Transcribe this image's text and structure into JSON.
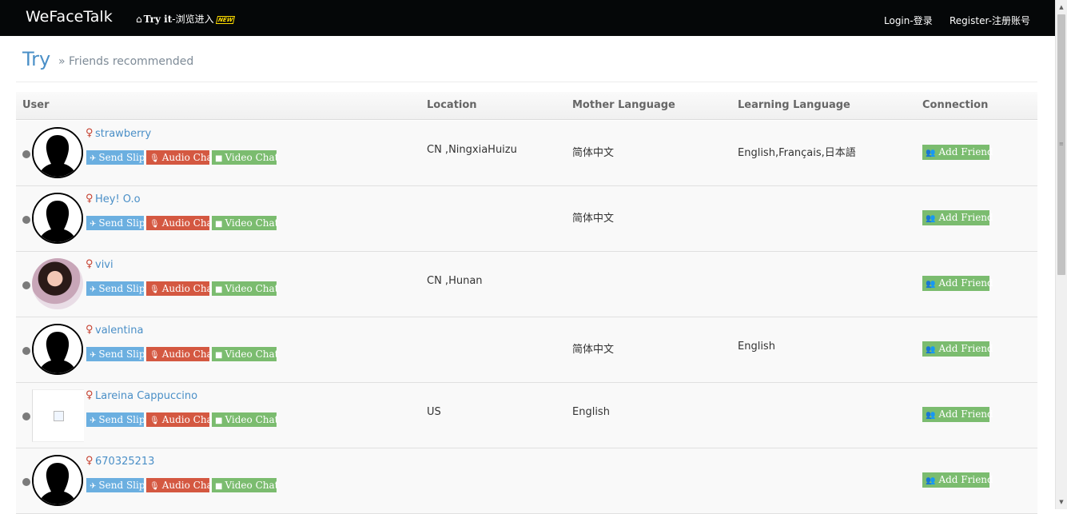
{
  "nav": {
    "brand": "WeFaceTalk",
    "try_icon": "home-icon",
    "try_label": "Try it",
    "try_cn": "-浏览进入",
    "new_badge": "NEW",
    "login": "Login-登录",
    "register": "Register-注册账号"
  },
  "page": {
    "title": "Try",
    "subtitle": "» Friends recommended"
  },
  "table": {
    "headers": {
      "user": "User",
      "location": "Location",
      "mother": "Mother Language",
      "learning": "Learning Language",
      "connection": "Connection"
    },
    "buttons": {
      "send_slip": "Send Slip",
      "audio_chat": "Audio Chat",
      "video_chat": "Video Chat",
      "add_friend": "Add Friend"
    },
    "gender_symbol": "♀",
    "rows": [
      {
        "name": "strawberry",
        "location": "CN ,NingxiaHuizu",
        "mother": "简体中文",
        "learning": "English,Français,日本語",
        "avatar": "silhouette"
      },
      {
        "name": "Hey! O.o",
        "location": "",
        "mother": "简体中文",
        "learning": "",
        "avatar": "silhouette"
      },
      {
        "name": "vivi",
        "location": "CN ,Hunan",
        "mother": "",
        "learning": "",
        "avatar": "photo"
      },
      {
        "name": "valentina",
        "location": "",
        "mother": "简体中文",
        "learning": "English",
        "avatar": "silhouette"
      },
      {
        "name": "Lareina Cappuccino",
        "location": "US",
        "mother": "English",
        "learning": "",
        "avatar": "broken-image"
      },
      {
        "name": "670325213",
        "location": "",
        "mother": "",
        "learning": "",
        "avatar": "silhouette"
      }
    ]
  },
  "colors": {
    "navbar": "#050708",
    "link": "#4a8fc7",
    "send_slip": "#6bafe0",
    "audio_chat": "#d45841",
    "video_chat": "#7bbc6f",
    "add_friend": "#7bbc6f",
    "female": "#c5402f"
  }
}
